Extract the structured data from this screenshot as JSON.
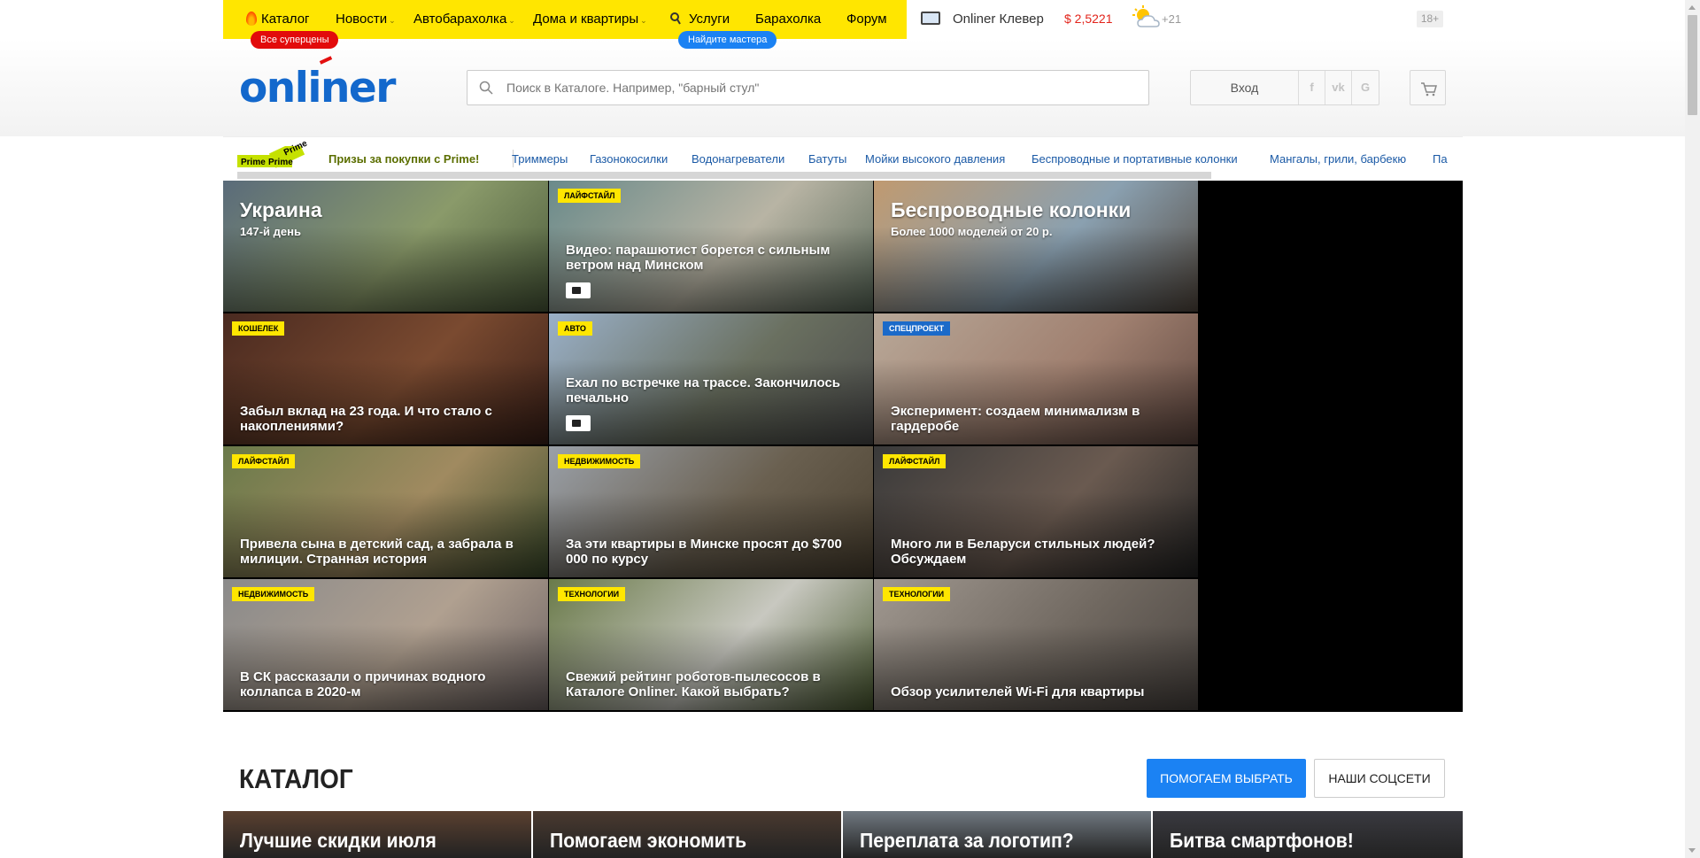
{
  "topnav": {
    "items": [
      {
        "label": "Каталог",
        "chevron": false
      },
      {
        "label": "Новости",
        "chevron": true
      },
      {
        "label": "Автобарахолка",
        "chevron": true
      },
      {
        "label": "Дома и квартиры",
        "chevron": true
      },
      {
        "label": "Услуги",
        "chevron": false
      },
      {
        "label": "Барахолка",
        "chevron": false
      },
      {
        "label": "Форум",
        "chevron": false
      }
    ],
    "catalog_pill": "Все суперцены",
    "services_pill": "Найдите мастера",
    "clever": "Onliner Клевер",
    "rate": "$ 2,5221",
    "temp": "+21",
    "age": "18+"
  },
  "header": {
    "logo": "onliner",
    "search_placeholder": "Поиск в Каталоге. Например, \"барный стул\"",
    "login": "Вход",
    "social": [
      "f",
      "vk",
      "G"
    ]
  },
  "categories": {
    "prime_badge": "Prime",
    "prime_text": "Призы за покупки с Prime!",
    "links": [
      "Триммеры",
      "Газонокосилки",
      "Водонагреватели",
      "Батуты",
      "Мойки высокого давления",
      "Беспроводные и портативные колонки",
      "Мангалы, грили, барбекю",
      "Па"
    ]
  },
  "news": [
    {
      "big": true,
      "title": "Украина",
      "sub": "147-й день",
      "tag": "",
      "video": false,
      "colors": [
        "#5a6b7a",
        "#8a9a6a",
        "#4a5a3a"
      ]
    },
    {
      "big": false,
      "title": "Видео: парашютист борется с сильным ветром над Минском",
      "tag": "Лайфстайл",
      "video": true,
      "colors": [
        "#6a8a8a",
        "#b8b4a4",
        "#5a6a5a"
      ]
    },
    {
      "big": true,
      "title": "Беспроводные колонки",
      "sub": "Более 1000 моделей от 20 р.",
      "tag": "",
      "video": false,
      "colors": [
        "#c09a70",
        "#8aa0b0",
        "#554a40"
      ]
    },
    {
      "big": false,
      "title": "Забыл вклад на 23 года. И что стало с накоплениями?",
      "tag": "Кошелек",
      "video": false,
      "colors": [
        "#4a2a20",
        "#7a4a30",
        "#3a2018"
      ]
    },
    {
      "big": false,
      "title": "Ехал по встречке на трассе. Закончилось печально",
      "tag": "Авто",
      "video": true,
      "colors": [
        "#9ab0c8",
        "#6a7060",
        "#4a4a4a"
      ]
    },
    {
      "big": false,
      "title": "Эксперимент: создаем минимализм в гардеробе",
      "tag": "Спецпроект",
      "tagBlue": true,
      "video": false,
      "colors": [
        "#b8a898",
        "#a08070",
        "#604840"
      ]
    },
    {
      "big": false,
      "title": "Привела сына в детский сад, а забрала в милиции. Странная история",
      "tag": "Лайфстайл",
      "video": false,
      "colors": [
        "#6a7a4a",
        "#a08a60",
        "#3a4a2a"
      ]
    },
    {
      "big": false,
      "title": "За эти квартиры в Минске просят до $700 000 по курсу",
      "tag": "Недвижимость",
      "video": false,
      "colors": [
        "#9aa0a8",
        "#6a6050",
        "#4a4030"
      ]
    },
    {
      "big": false,
      "title": "Много ли в Беларуси стильных людей? Обсуждаем",
      "tag": "Лайфстайл",
      "video": false,
      "colors": [
        "#3a3a3a",
        "#6a5a50",
        "#222222"
      ]
    },
    {
      "big": false,
      "title": "В СК рассказали о причинах водного коллапса в 2020-м",
      "tag": "Недвижимость",
      "video": false,
      "colors": [
        "#8a8a8a",
        "#b0a090",
        "#6a6060"
      ]
    },
    {
      "big": false,
      "title": "Свежий рейтинг роботов-пылесосов в Каталоге Onliner. Какой выбрать?",
      "tag": "Технологии",
      "video": false,
      "colors": [
        "#6a7a4a",
        "#c8c8c0",
        "#4a5a30"
      ]
    },
    {
      "big": false,
      "title": "Обзор усилителей Wi-Fi для квартиры",
      "tag": "Технологии",
      "video": false,
      "colors": [
        "#a09890",
        "#706860",
        "#4a4440"
      ]
    }
  ],
  "catalog": {
    "title": "КАТАЛОГ",
    "help_btn": "ПОМОГАЕМ ВЫБРАТЬ",
    "social_btn": "НАШИ СОЦСЕТИ",
    "promos": [
      {
        "title": "Лучшие скидки июля",
        "color": "#5a4030"
      },
      {
        "title": "Помогаем экономить",
        "color": "#4a3a30"
      },
      {
        "title": "Переплата за логотип?",
        "color": "#707880"
      },
      {
        "title": "Битва смартфонов!",
        "color": "#3a3a40"
      }
    ]
  },
  "colors": {
    "yellow": "#ffe600",
    "blue": "#1b82f3",
    "logo_blue": "#1368cc",
    "red": "#e20b0b"
  }
}
